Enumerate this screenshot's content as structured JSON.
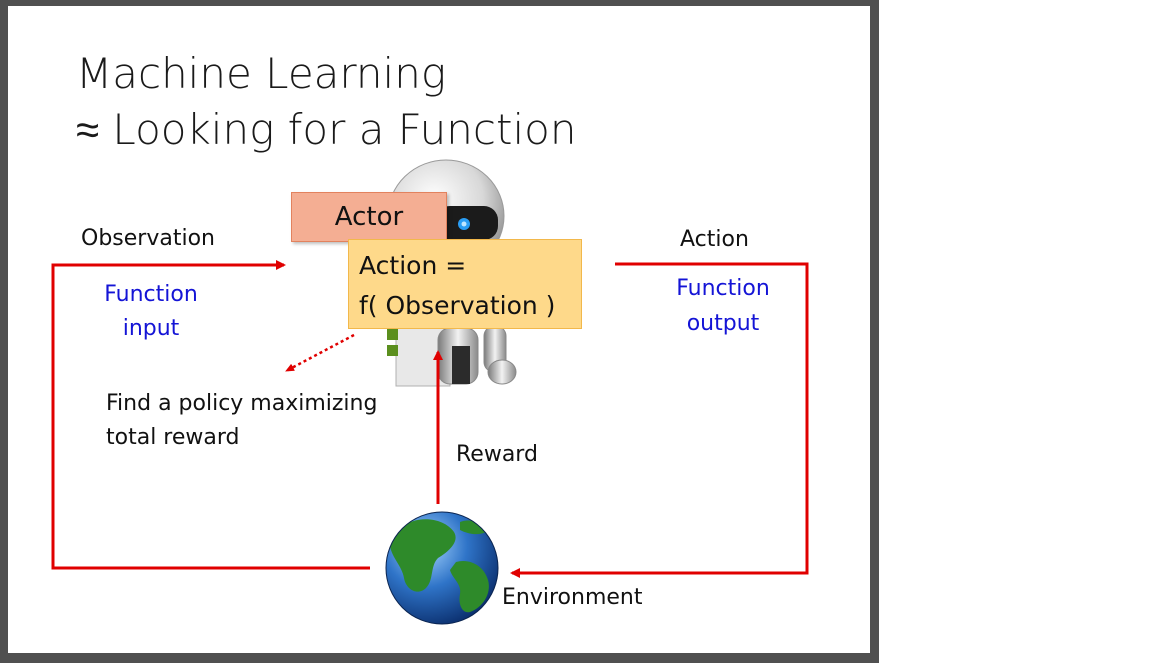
{
  "slide": {
    "title_line1": "Machine Learning",
    "title_line2": "≈ Looking for a Function",
    "actor": "Actor",
    "formula_line1": "Action =",
    "formula_line2": "f( Observation )",
    "observation": "Observation",
    "function_input_line1": "Function",
    "function_input_line2": "input",
    "action": "Action",
    "function_output_line1": "Function",
    "function_output_line2": "output",
    "policy_line1": "Find a policy maximizing",
    "policy_line2": "total reward",
    "reward": "Reward",
    "environment": "Environment"
  },
  "colors": {
    "arrow": "#e00000",
    "blue_text": "#1414d6",
    "actor_fill": "#f4ae93",
    "formula_fill": "#fed98a"
  },
  "icons": [
    "robot-image",
    "globe-image"
  ]
}
